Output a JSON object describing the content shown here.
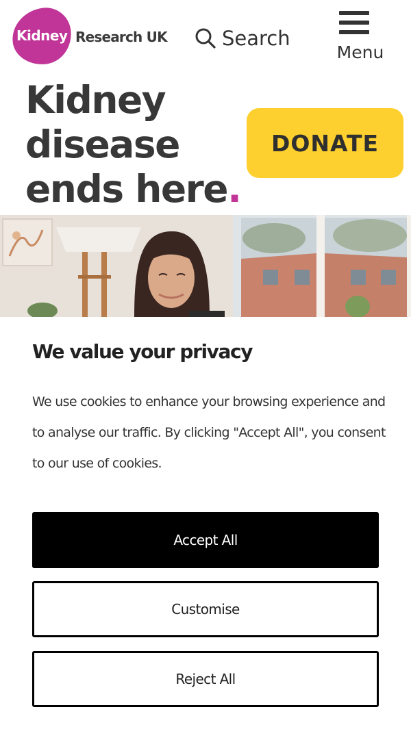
{
  "header": {
    "logo": {
      "mark_text": "Kidney",
      "rest_text": "Research UK"
    },
    "search": {
      "label": "Search",
      "icon": "search-icon"
    },
    "menu": {
      "label": "Menu",
      "icon": "hamburger-icon"
    }
  },
  "hero": {
    "title_lines": [
      "Kidney",
      "disease",
      "ends here"
    ],
    "title_dot": ".",
    "donate_label": "DONATE"
  },
  "colors": {
    "brand_magenta": "#c03597",
    "donate_yellow": "#fdd02f",
    "text_dark": "#333333",
    "accept_bg": "#000000"
  },
  "cookie_banner": {
    "title": "We value your privacy",
    "body": "We use cookies to enhance your browsing experience and to analyse our traffic. By clicking \"Accept All\", you consent to our use of cookies.",
    "buttons": {
      "accept": "Accept All",
      "customise": "Customise",
      "reject": "Reject All"
    }
  }
}
